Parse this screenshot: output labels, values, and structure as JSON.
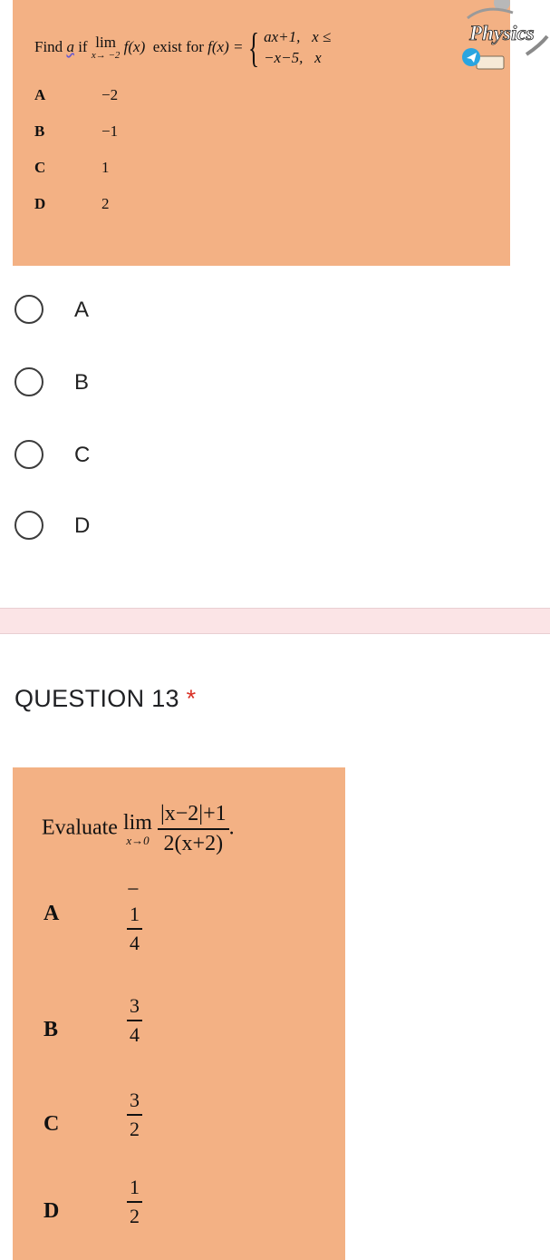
{
  "q12": {
    "statement": {
      "find": "Find",
      "var": "a",
      "if": "if",
      "lim": "lim",
      "lim_sub": "x→ −2",
      "fx": "f(x)",
      "exist_for": "exist for",
      "fx_eq": "f(x) =",
      "case1_expr": "ax+1,",
      "case1_cond": "x ≤",
      "case2_expr": "−x−5,",
      "case2_cond": "x"
    },
    "image_options": [
      {
        "letter": "A",
        "value": "−2"
      },
      {
        "letter": "B",
        "value": "−1"
      },
      {
        "letter": "C",
        "value": "1"
      },
      {
        "letter": "D",
        "value": "2"
      }
    ],
    "watermark": "Physics",
    "radio_options": [
      "A",
      "B",
      "C",
      "D"
    ]
  },
  "q13": {
    "title": "QUESTION 13",
    "required_mark": "*",
    "statement": {
      "evaluate": "Evaluate",
      "lim": "lim",
      "lim_sub": "x→0",
      "numerator": "|x−2|+1",
      "denominator": "2(x+2)",
      "trail": "."
    },
    "image_options": [
      {
        "letter": "A",
        "sign": "−",
        "num": "1",
        "den": "4"
      },
      {
        "letter": "B",
        "sign": "",
        "num": "3",
        "den": "4"
      },
      {
        "letter": "C",
        "sign": "",
        "num": "3",
        "den": "2"
      },
      {
        "letter": "D",
        "sign": "",
        "num": "1",
        "den": "2"
      }
    ]
  },
  "colors": {
    "question_image_bg": "#f3b184",
    "separator": "#fbe4e6",
    "required": "#d93025"
  }
}
